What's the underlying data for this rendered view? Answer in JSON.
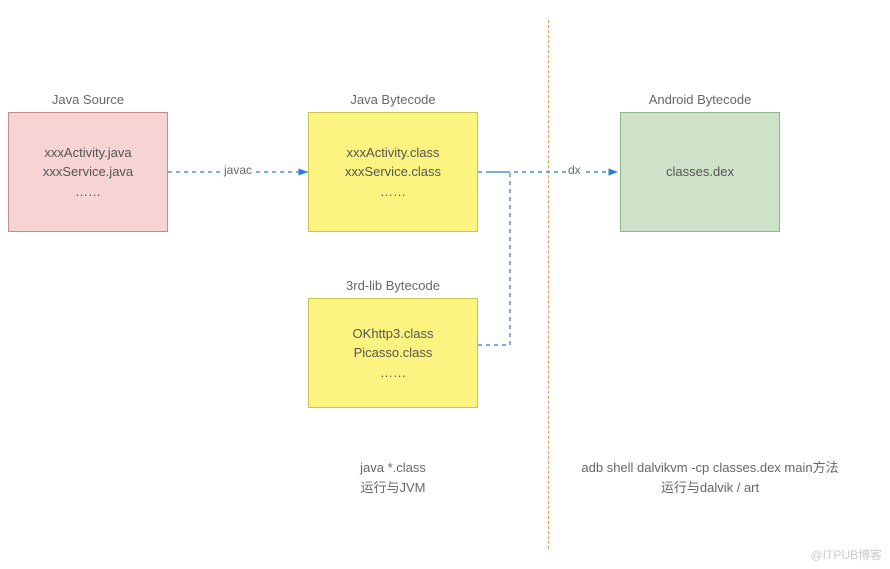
{
  "boxes": {
    "source": {
      "title": "Java Source",
      "line1": "xxxActivity.java",
      "line2": "xxxService.java",
      "line3": "……"
    },
    "javaBytecode": {
      "title": "Java Bytecode",
      "line1": "xxxActivity.class",
      "line2": "xxxService.class",
      "line3": "……"
    },
    "thirdLib": {
      "title": "3rd-lib Bytecode",
      "line1": "OKhttp3.class",
      "line2": "Picasso.class",
      "line3": "……"
    },
    "android": {
      "title": "Android Bytecode",
      "line1": "classes.dex"
    }
  },
  "arrows": {
    "javac": "javac",
    "dx": "dx"
  },
  "captions": {
    "left": {
      "line1": "java *.class",
      "line2": "运行与JVM"
    },
    "right": {
      "line1": "adb shell dalvikvm -cp  classes.dex  main方法",
      "line2": "运行与dalvik / art"
    }
  },
  "watermark": "@ITPUB博客"
}
